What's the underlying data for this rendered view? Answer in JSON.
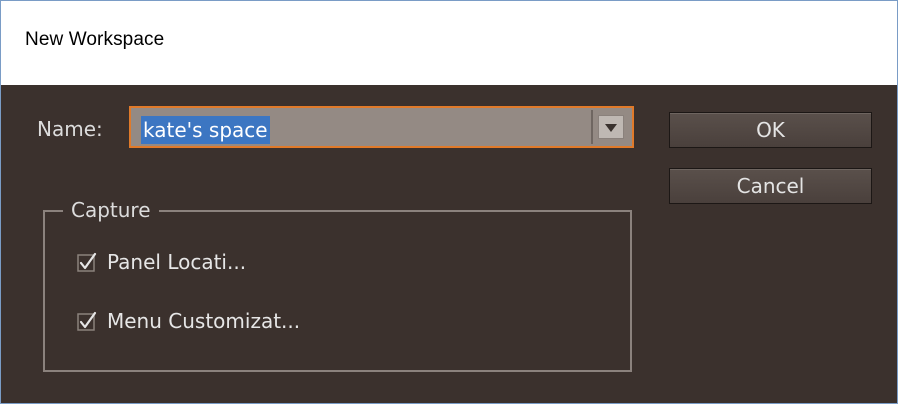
{
  "window": {
    "title": "New Workspace"
  },
  "name_field": {
    "label": "Name:",
    "value": "kate's space"
  },
  "buttons": {
    "ok_label": "OK",
    "cancel_label": "Cancel"
  },
  "capture": {
    "title": "Capture",
    "options": [
      {
        "label": "Panel Locati...",
        "checked": true
      },
      {
        "label": "Menu Customizat...",
        "checked": true
      }
    ]
  },
  "colors": {
    "dialog_bg": "#3b312d",
    "focus_border": "#e07a2a",
    "selection": "#3c76c2"
  },
  "icons": [
    "chevron-down-icon",
    "checkmark-icon"
  ]
}
